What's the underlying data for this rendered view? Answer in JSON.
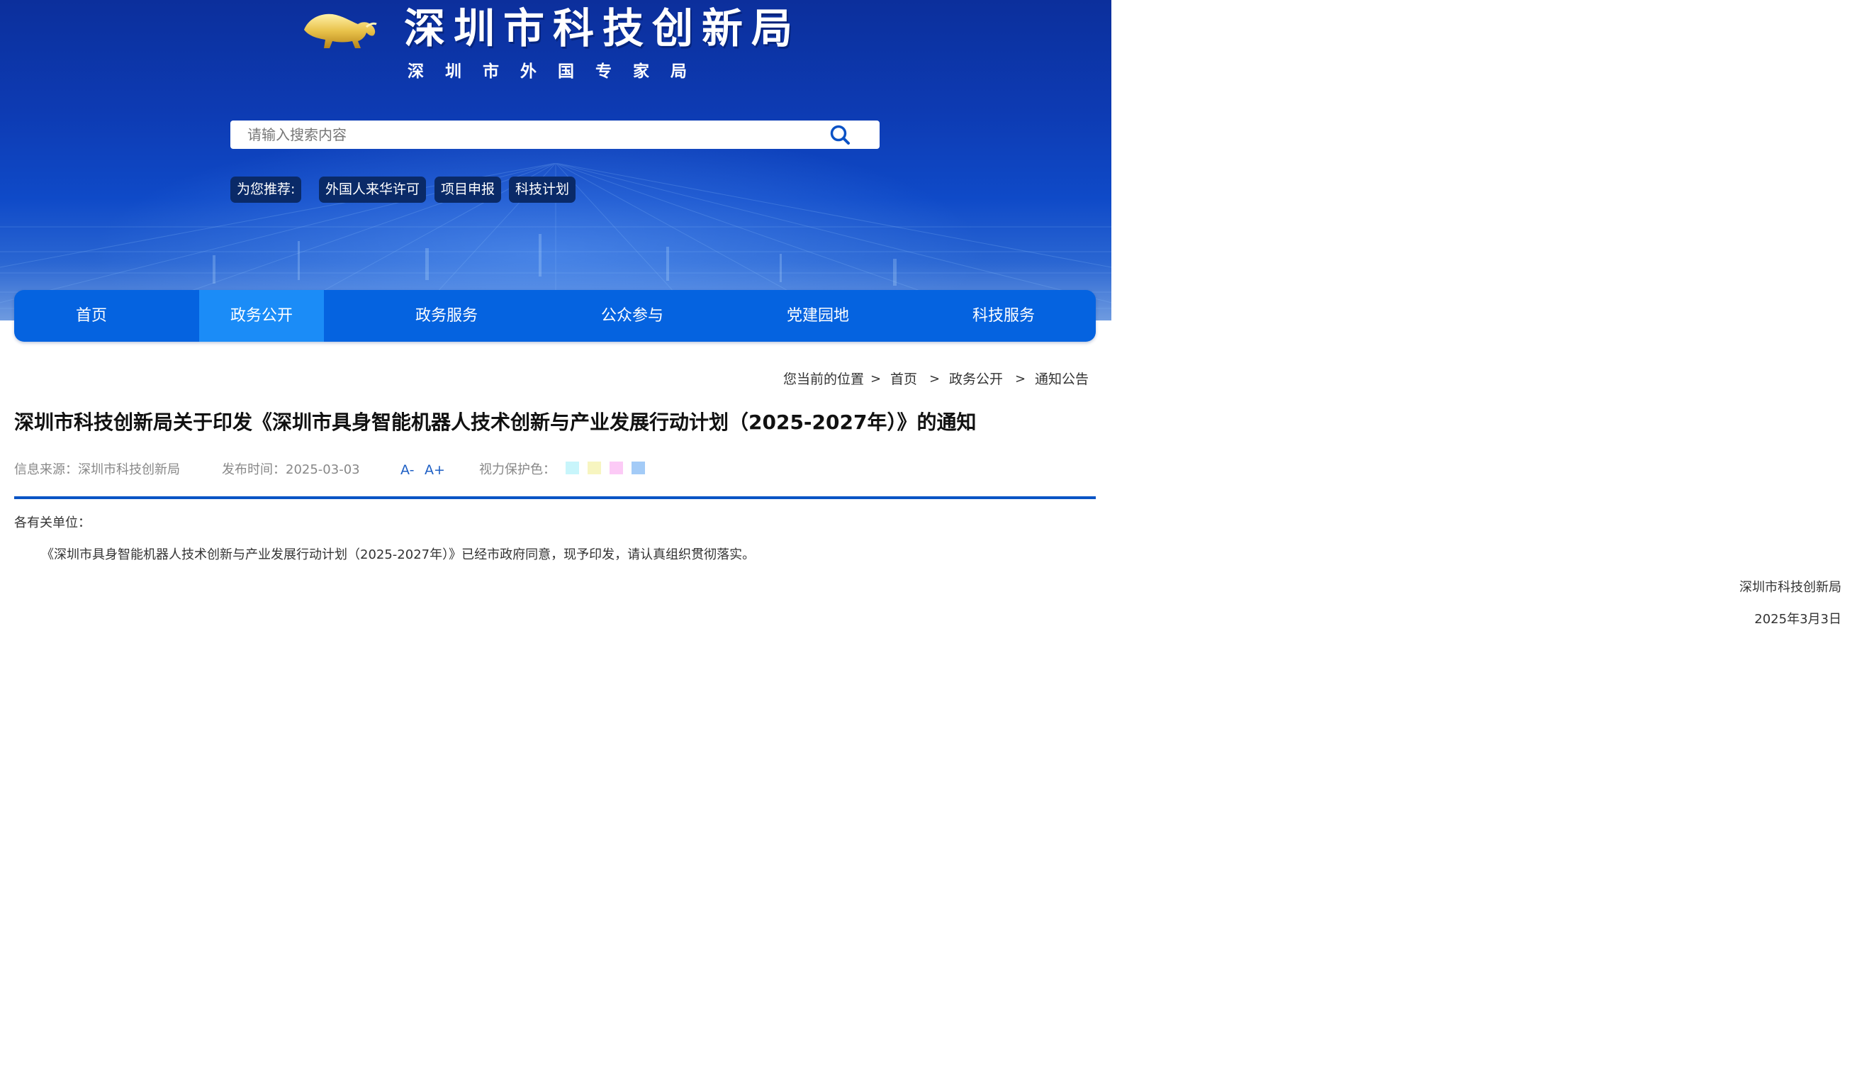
{
  "header": {
    "title": "深圳市科技创新局",
    "subtitle": "深圳市外国专家局",
    "logo_icon": "golden-bull-logo",
    "search": {
      "placeholder": "请输入搜索内容",
      "icon": "search-icon"
    },
    "recommend_label": "为您推荐:",
    "recommend_links": [
      "外国人来华许可",
      "项目申报",
      "科技计划"
    ]
  },
  "nav": {
    "items": [
      "首页",
      "政务公开",
      "政务服务",
      "公众参与",
      "党建园地",
      "科技服务"
    ],
    "active": "政务公开"
  },
  "breadcrumb": {
    "prefix": "您当前的位置",
    "items": [
      "首页",
      "政务公开",
      "通知公告"
    ],
    "separator": ">"
  },
  "article": {
    "title": "深圳市科技创新局关于印发《深圳市具身智能机器人技术创新与产业发展行动计划（2025-2027年）》的通知",
    "source": "信息来源：深圳市科技创新局",
    "publish_time": "发布时间：2025-03-03",
    "font_decrease": "A-",
    "font_increase": "A+",
    "eye_care_label": "视力保护色：",
    "eye_care_colors": [
      "#c8f5fb",
      "#f7f5c0",
      "#fccaf6",
      "#a3cbf7"
    ],
    "salutation": "各有关单位：",
    "paragraph": "《深圳市具身智能机器人技术创新与产业发展行动计划（2025-2027年）》已经市政府同意，现予印发，请认真组织贯彻落实。",
    "signature": "深圳市科技创新局",
    "date": "2025年3月3日"
  },
  "colors": {
    "banner_top": "#0c2f9c",
    "nav_bg": "#0563e0",
    "nav_active": "#1b8cf7",
    "rule": "#0a55c5",
    "tag_bg": "#0a2a68"
  }
}
